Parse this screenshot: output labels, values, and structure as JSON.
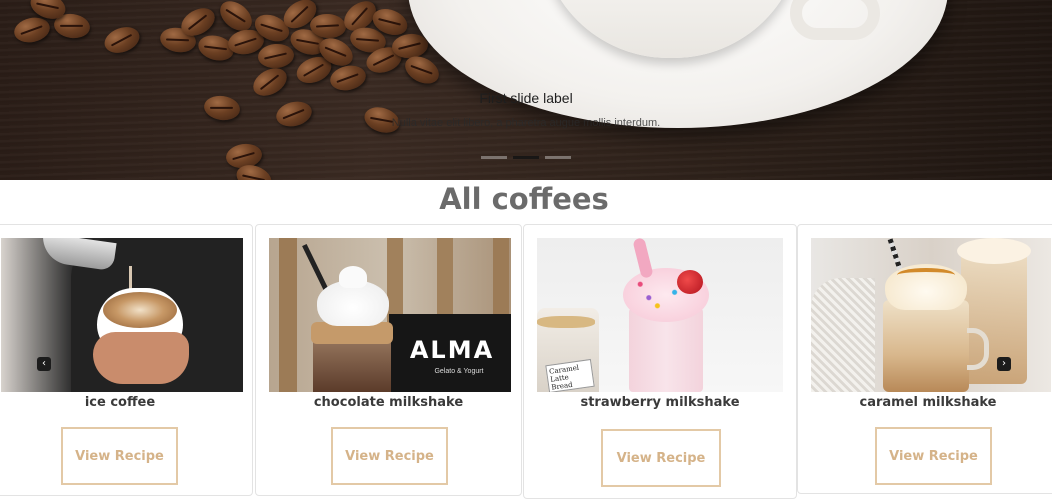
{
  "hero": {
    "slide_title": "First slide label",
    "slide_text": "Nulla vitae elit libero, a pharetra augue mollis interdum.",
    "indicators": 3,
    "active_indicator": 1
  },
  "section": {
    "title": "All coffees"
  },
  "cards": [
    {
      "name": "ice coffee",
      "button": "View Recipe"
    },
    {
      "name": "chocolate milkshake",
      "button": "View Recipe",
      "sign_text": "ALMA",
      "sign_subtext": "Gelato & Yogurt"
    },
    {
      "name": "strawberry milkshake",
      "button": "View Recipe",
      "jar_label": "Caramel\nLatte Bread"
    },
    {
      "name": "caramel milkshake",
      "button": "View Recipe"
    }
  ],
  "carousel_controls": {
    "prev_icon": "‹",
    "next_icon": "›"
  },
  "colors": {
    "accent": "#d5b389",
    "button_border": "#e3c9a6",
    "title_gray": "#6b6b6b"
  }
}
